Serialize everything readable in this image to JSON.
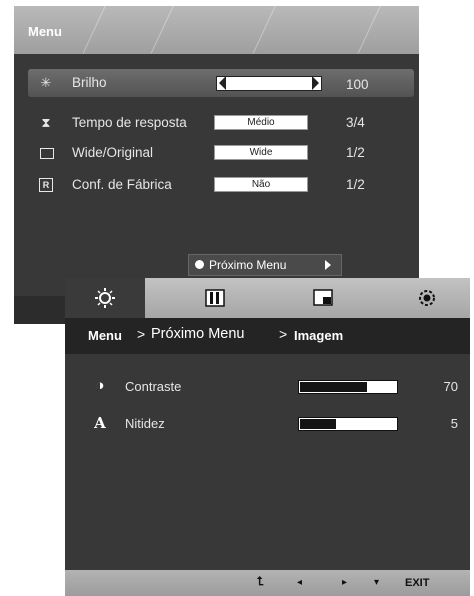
{
  "main_menu": {
    "title": "Menu",
    "items": [
      {
        "label": "Brilho",
        "value": "100",
        "level": 1.0,
        "icon": "sun-icon",
        "selected": true
      },
      {
        "label": "Tempo de resposta",
        "setting": "Médio",
        "value": "3/4",
        "icon": "hourglass-icon"
      },
      {
        "label": "Wide/Original",
        "setting": "Wide",
        "value": "1/2",
        "icon": "aspect-ratio-icon"
      },
      {
        "label": "Conf. de Fábrica",
        "setting": "Não",
        "value": "1/2",
        "icon": "reset-icon"
      }
    ],
    "next_menu_label": "Próximo Menu"
  },
  "sub_menu": {
    "tabs": [
      {
        "name": "brightness-tab",
        "icon": "sun-icon",
        "active": true
      },
      {
        "name": "picture-tab",
        "icon": "contrast-bars-icon"
      },
      {
        "name": "display-tab",
        "icon": "monitor-icon"
      },
      {
        "name": "settings-tab",
        "icon": "gear-icon"
      }
    ],
    "breadcrumb": {
      "root": "Menu",
      "sep": ">",
      "middle": "Próximo Menu",
      "current": "Imagem"
    },
    "items": [
      {
        "label": "Contraste",
        "value": "70",
        "level": 0.7,
        "icon": "contrast-icon"
      },
      {
        "label": "Nitidez",
        "value": "5",
        "level": 0.38,
        "icon": "sharpness-icon"
      }
    ],
    "footer": {
      "up": "⮤",
      "left": "◂",
      "right": "▸",
      "down": "▾",
      "exit": "EXIT"
    }
  },
  "colors": {
    "panel": "#383838",
    "header": "#a9a9a9",
    "text": "#e6e6e6"
  }
}
